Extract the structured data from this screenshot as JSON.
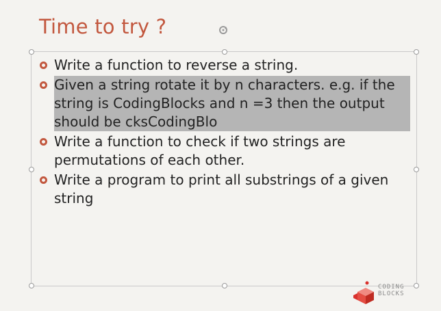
{
  "slide": {
    "title": "Time to try ?",
    "bullets": [
      {
        "text": "Write a function to reverse a string.",
        "selected": false
      },
      {
        "text": "Given a string rotate it by n characters. e.g. if the string is CodingBlocks and n =3 then the output should be cksCodingBlo",
        "selected": true
      },
      {
        "text": "Write a function to check if two strings are permutations of each other.",
        "selected": false
      },
      {
        "text": "Write a program to print all substrings of a given string",
        "selected": false
      }
    ]
  },
  "logo": {
    "line1": "CODING",
    "line2": "BLOCKS"
  },
  "colors": {
    "accent": "#c2573e",
    "selection": "#b5b5b5",
    "text": "#222222",
    "background": "#f4f3f0"
  },
  "icons": {
    "rotate": "rotate-handle-icon",
    "bullet": "hollow-circle-bullet-icon",
    "logo": "coding-blocks-cube-icon"
  }
}
